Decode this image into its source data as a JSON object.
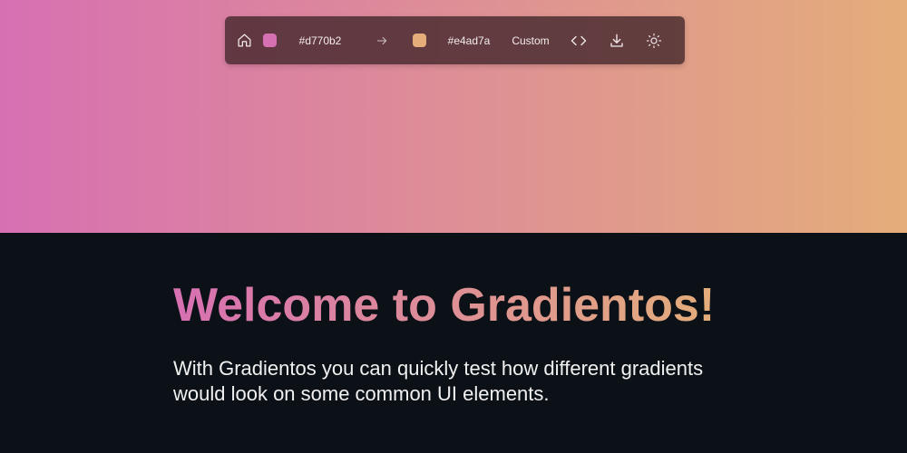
{
  "toolbar": {
    "color_start": "#d770b2",
    "color_end": "#e4ad7a",
    "direction_label": "Custom",
    "icons": [
      "home-icon",
      "arrow-right-icon",
      "code-icon",
      "download-icon",
      "sun-icon"
    ]
  },
  "colors": {
    "gradient_start": "#d770b2",
    "gradient_end": "#e4ad7a",
    "background": "#0c1118",
    "toolbar_bg": "#46282d"
  },
  "main": {
    "heading": "Welcome to Gradientos!",
    "description": "With Gradientos you can quickly test how different gradients would look on some common UI elements."
  }
}
